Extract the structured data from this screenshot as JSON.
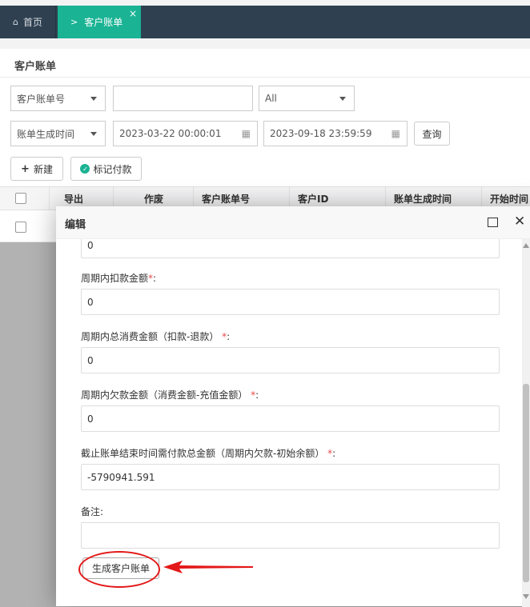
{
  "tabs": {
    "home_label": "首页",
    "active_label": "客户账单",
    "close_glyph": "×"
  },
  "page": {
    "title": "客户账单"
  },
  "filters": {
    "field_select": "客户账单号",
    "keyword_value": "",
    "status_select": "All",
    "time_select": "账单生成时间",
    "start_time": "2023-03-22 00:00:01",
    "end_time": "2023-09-18 23:59:59",
    "query_label": "查询"
  },
  "toolbar": {
    "new_label": "新建",
    "mark_paid_label": "标记付款"
  },
  "table": {
    "columns": [
      "导出",
      "作废",
      "客户账单号",
      "客户ID",
      "账单生成时间",
      "开始时间"
    ]
  },
  "modal": {
    "title": "编辑",
    "fields": [
      {
        "label": "",
        "required": false,
        "value": "0"
      },
      {
        "label": "周期内扣款金额",
        "required": true,
        "value": "0"
      },
      {
        "label": "周期内总消费金额（扣款-退款）",
        "required": true,
        "value": "0"
      },
      {
        "label": "周期内欠款金额（消费金额-充值金额）",
        "required": true,
        "value": "0"
      },
      {
        "label": "截止账单结束时间需付款总金额（周期内欠款-初始余额）",
        "required": true,
        "value": "-5790941.591"
      },
      {
        "label": "备注",
        "required": false,
        "value": ""
      }
    ],
    "required_mark": "*",
    "label_suffix": ":",
    "generate_label": "生成客户账单"
  },
  "colors": {
    "sidebar_dark": "#2f4050",
    "active_tab": "#1ab394",
    "annotation_red": "#e31818",
    "required_red": "#e84a4a"
  },
  "icons": {
    "home": "home-icon",
    "chevron": "chevron-right-icon",
    "calendar": "calendar-icon",
    "plus": "plus-icon",
    "check_circle": "check-circle-icon",
    "maximize": "maximize-icon",
    "close": "close-icon"
  }
}
